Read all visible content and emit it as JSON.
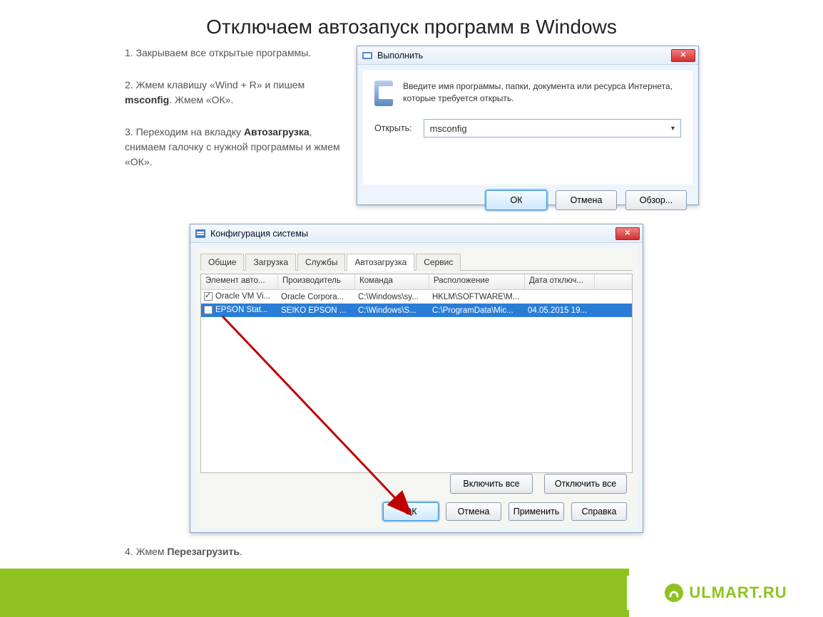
{
  "page_title": "Отключаем автозапуск программ в Windows",
  "steps": {
    "s1": "1. Закрываем все открытые программы.",
    "s2a": "2. Жмем клавишу «Wind + R» и пишем ",
    "s2b": "msconfig",
    "s2c": ". Жмем «ОК».",
    "s3a": "3. Переходим на вкладку ",
    "s3b": "Автозагрузка",
    "s3c": ", снимаем галочку с нужной программы и жмем «ОК».",
    "s4a": "4. Жмем ",
    "s4b": "Перезагрузить",
    "s4c": "."
  },
  "run": {
    "title": "Выполнить",
    "desc": "Введите имя программы, папки, документа или ресурса Интернета, которые требуется открыть.",
    "open_label": "Открыть:",
    "value": "msconfig",
    "ok": "ОК",
    "cancel": "Отмена",
    "browse": "Обзор..."
  },
  "msconfig": {
    "title": "Конфигурация системы",
    "tabs": [
      "Общие",
      "Загрузка",
      "Службы",
      "Автозагрузка",
      "Сервис"
    ],
    "active_tab": 3,
    "headers": [
      "Элемент авто...",
      "Производитель",
      "Команда",
      "Расположение",
      "Дата отключ..."
    ],
    "rows": [
      {
        "checked": true,
        "c": [
          "Oracle VM Vi...",
          "Oracle Corpora...",
          "C:\\Windows\\sy...",
          "HKLM\\SOFTWARE\\M...",
          ""
        ]
      },
      {
        "checked": false,
        "selected": true,
        "c": [
          "EPSON Stat...",
          "SEIKO EPSON ...",
          "C:\\Windows\\S...",
          "C:\\ProgramData\\Mic...",
          "04.05.2015 19..."
        ]
      }
    ],
    "enable_all": "Включить все",
    "disable_all": "Отключить все",
    "ok": "ОК",
    "cancel": "Отмена",
    "apply": "Применить",
    "help": "Справка"
  },
  "footer": {
    "brand": "ULMART.RU"
  }
}
